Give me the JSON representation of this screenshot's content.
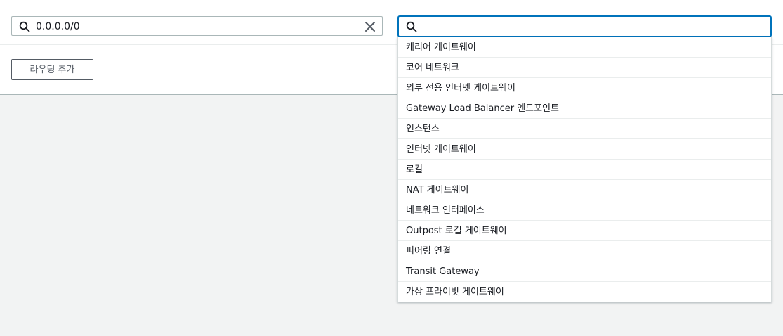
{
  "destination": {
    "value": "0.0.0.0/0",
    "search_icon": "search-icon",
    "clear_icon": "close-icon"
  },
  "target": {
    "value": "",
    "placeholder": "",
    "search_icon": "search-icon"
  },
  "add_route_label": "라우팅 추가",
  "dropdown": {
    "items": [
      "캐리어 게이트웨이",
      "코어 네트워크",
      "외부 전용 인터넷 게이트웨이",
      "Gateway Load Balancer 엔드포인트",
      "인스턴스",
      "인터넷 게이트웨이",
      "로컬",
      "NAT 게이트웨이",
      "네트워크 인터페이스",
      "Outpost 로컬 게이트웨이",
      "피어링 연결",
      "Transit Gateway",
      "가상 프라이빗 게이트웨이"
    ]
  },
  "colors": {
    "focus_border": "#0073bb",
    "page_background": "#f2f3f3",
    "text": "#16191f"
  }
}
